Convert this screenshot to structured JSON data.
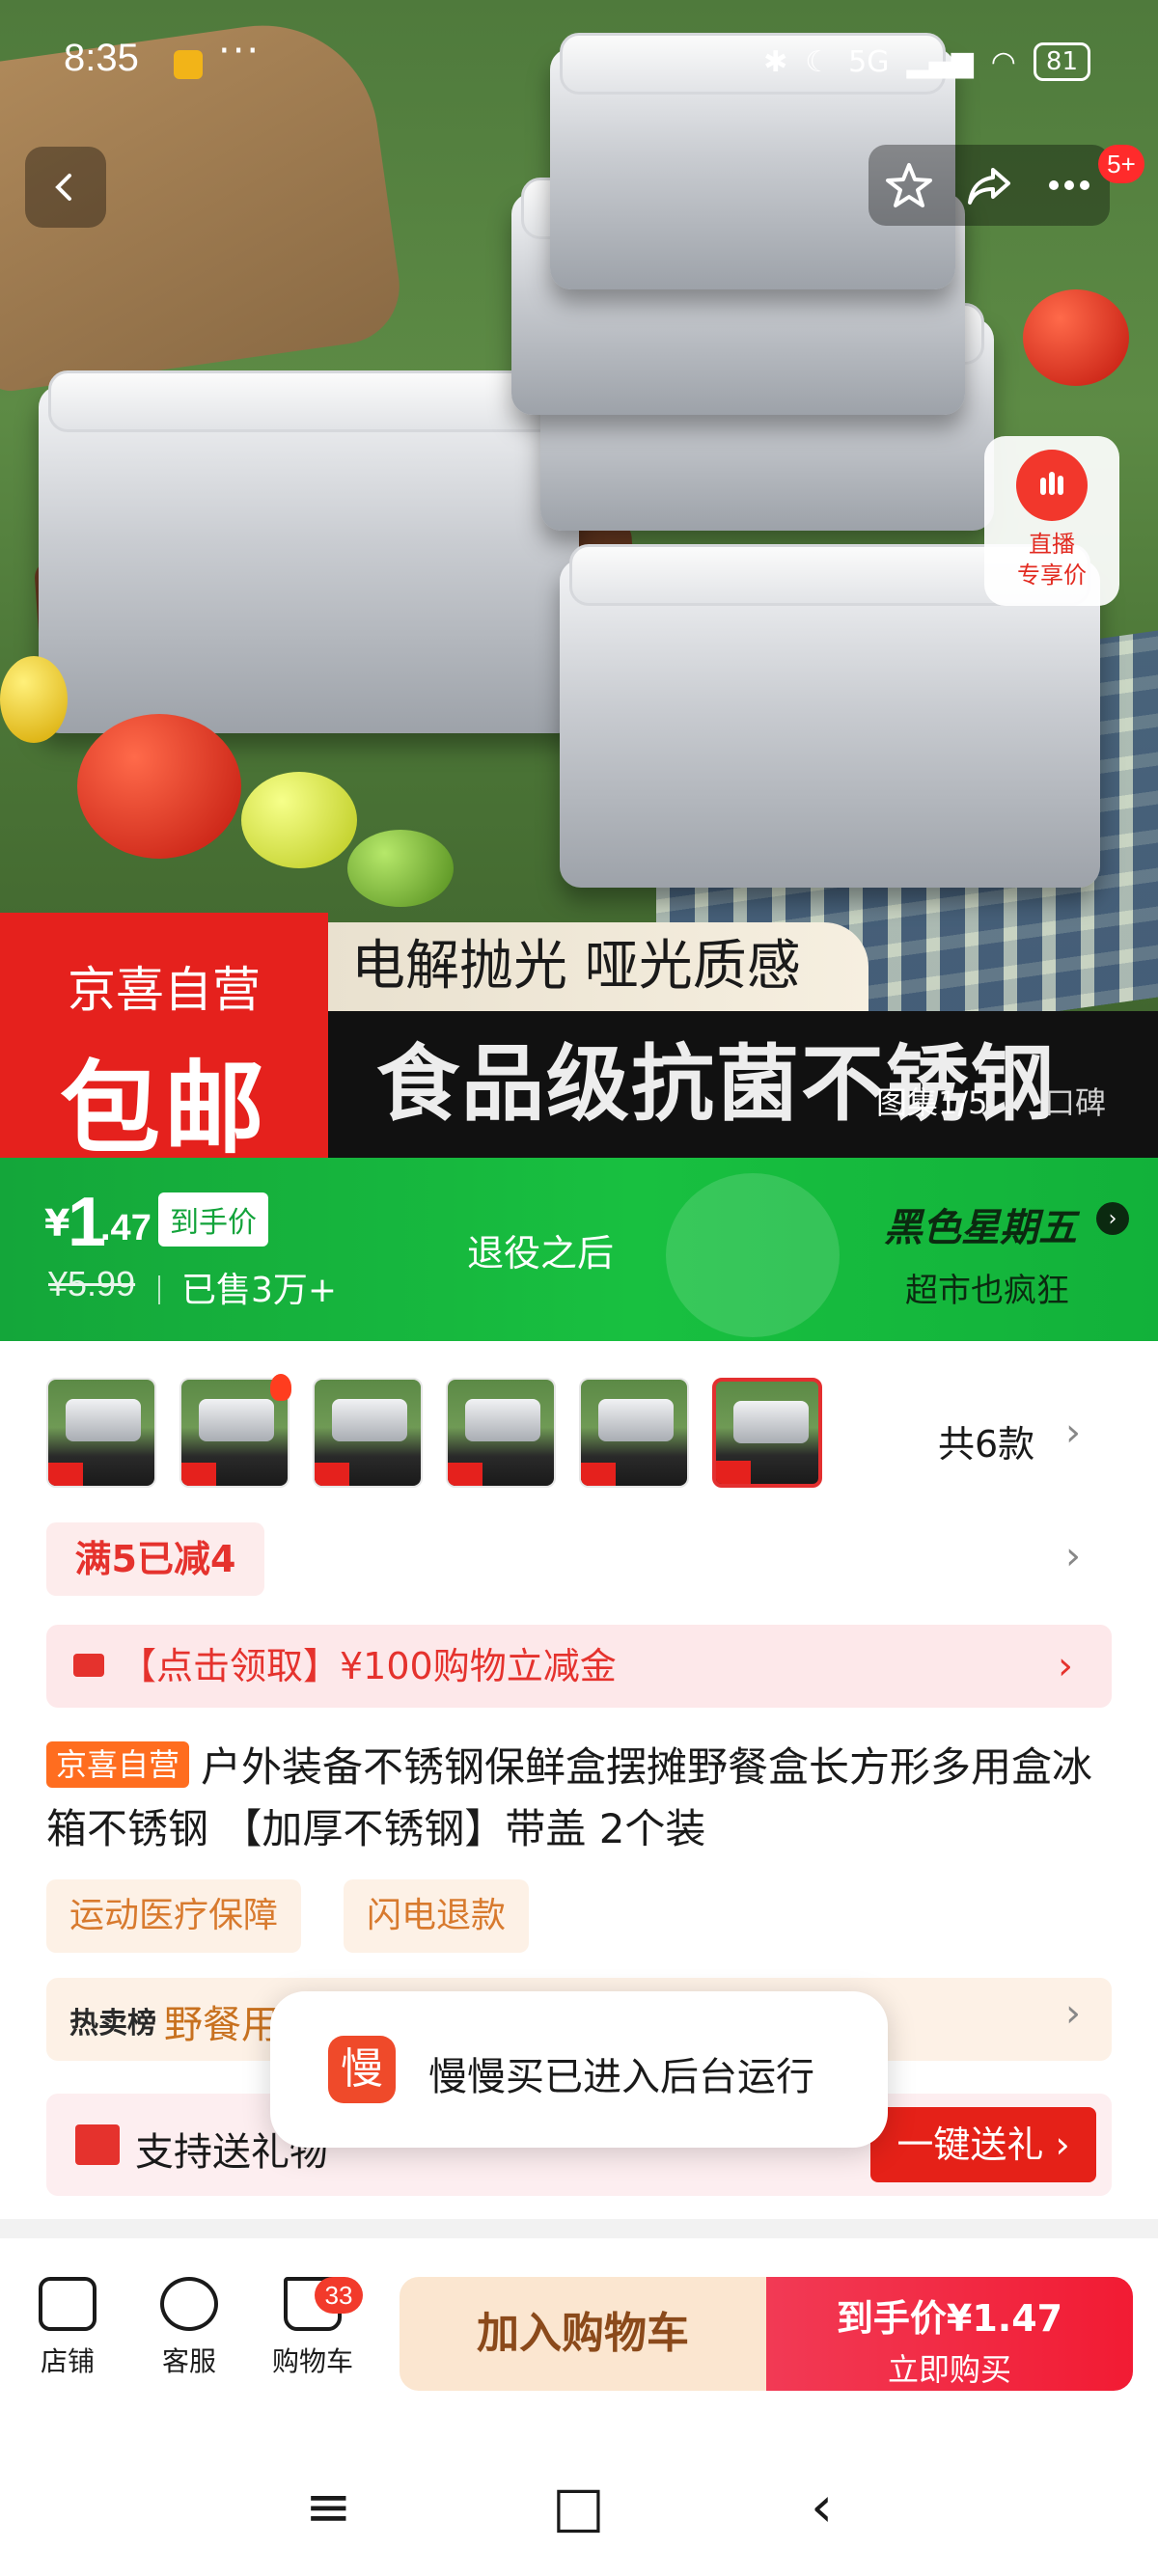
{
  "status_bar": {
    "time": "8:35",
    "dots": "···",
    "network": "5G",
    "battery": "81"
  },
  "header": {
    "more_badge": "5+"
  },
  "live": {
    "label_line1": "直播",
    "label_line2": "专享价"
  },
  "hero": {
    "banner_brand": "京喜自营",
    "banner_free_shipping": "包邮",
    "banner_slogan": "电解抛光 哑光质感",
    "banner_headline": "食品级抗菌不锈钢",
    "gallery_index": "图集1/5",
    "reviews_link": "口碑"
  },
  "promo": {
    "currency": "¥",
    "price_int": "1",
    "price_dec": ".47",
    "price_tag": "到手价",
    "original_price": "¥5.99",
    "sold": "已售3万+",
    "middle_text": "退役之后",
    "event_title": "黑色星期五",
    "event_sub": "超市也疯狂"
  },
  "variants": {
    "count_label": "共6款"
  },
  "coupon": {
    "label": "满5已减4"
  },
  "voucher": {
    "text": "【点击领取】¥100购物立减金"
  },
  "product": {
    "tag": "京喜自营",
    "title": "户外装备不锈钢保鲜盒摆摊野餐盒长方形多用盒冰箱不锈钢 【加厚不锈钢】带盖 2个装"
  },
  "services": [
    "运动医疗保障",
    "闪电退款"
  ],
  "hot": {
    "label": "热卖榜",
    "text": "野餐用"
  },
  "gift": {
    "text": "支持送礼物",
    "button": "一键送礼 ›"
  },
  "toast": {
    "icon_char": "慢",
    "text": "慢慢买已进入后台运行"
  },
  "bottom_nav": {
    "shop": "店铺",
    "service": "客服",
    "cart": "购物车",
    "cart_badge": "33",
    "add_to_cart": "加入购物车",
    "buy_line1": "到手价¥1.47",
    "buy_line2": "立即购买"
  },
  "colors": {
    "accent_red": "#e5211d",
    "promo_green": "#18c040",
    "toast_icon": "#ef4a2a"
  }
}
